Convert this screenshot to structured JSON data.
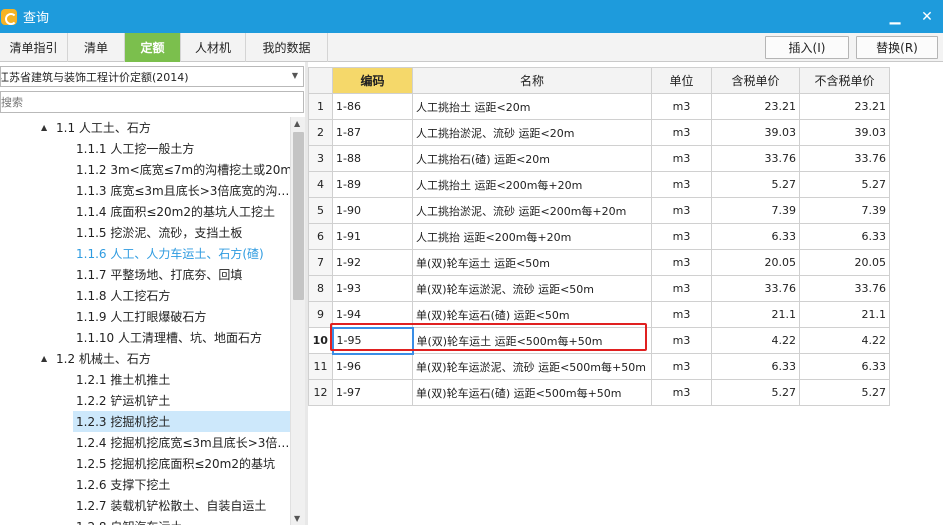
{
  "window": {
    "title": "查询",
    "minimize": "▁",
    "close": "✕"
  },
  "tabs": [
    {
      "label": "清单指引",
      "active": false
    },
    {
      "label": "清单",
      "active": false
    },
    {
      "label": "定额",
      "active": true
    },
    {
      "label": "人材机",
      "active": false
    },
    {
      "label": "我的数据",
      "active": false
    }
  ],
  "toolbar": {
    "insert_label": "插入(I)",
    "replace_label": "替换(R)"
  },
  "left": {
    "dropdown_value": "江苏省建筑与装饰工程计价定额(2014)",
    "search_placeholder": "搜索",
    "tree": [
      {
        "label": "1.1 人工土、石方",
        "level": 1,
        "expanded": true
      },
      {
        "label": "1.1.1 人工挖一般土方",
        "level": 2
      },
      {
        "label": "1.1.2 3m<底宽≤7m的沟槽挖土或20m2…",
        "level": 2
      },
      {
        "label": "1.1.3 底宽≤3m且底长>3倍底宽的沟…",
        "level": 2
      },
      {
        "label": "1.1.4 底面积≤20m2的基坑人工挖土",
        "level": 2
      },
      {
        "label": "1.1.5 挖淤泥、流砂，支挡土板",
        "level": 2
      },
      {
        "label": "1.1.6 人工、人力车运土、石方(碴)",
        "level": 2,
        "highlight": true
      },
      {
        "label": "1.1.7 平整场地、打底夯、回填",
        "level": 2
      },
      {
        "label": "1.1.8 人工挖石方",
        "level": 2
      },
      {
        "label": "1.1.9 人工打眼爆破石方",
        "level": 2
      },
      {
        "label": "1.1.10 人工清理槽、坑、地面石方",
        "level": 2
      },
      {
        "label": "1.2 机械土、石方",
        "level": 1,
        "expanded": true
      },
      {
        "label": "1.2.1 推土机推土",
        "level": 2
      },
      {
        "label": "1.2.2 铲运机铲土",
        "level": 2
      },
      {
        "label": "1.2.3 挖掘机挖土",
        "level": 2,
        "selected": true
      },
      {
        "label": "1.2.4 挖掘机挖底宽≤3m且底长>3倍…",
        "level": 2
      },
      {
        "label": "1.2.5 挖掘机挖底面积≤20m2的基坑",
        "level": 2
      },
      {
        "label": "1.2.6 支撑下挖土",
        "level": 2
      },
      {
        "label": "1.2.7 装载机铲松散土、自装自运土",
        "level": 2
      },
      {
        "label": "1.2.8 自卸汽车运土",
        "level": 2
      }
    ]
  },
  "grid": {
    "headers": [
      "",
      "编码",
      "名称",
      "单位",
      "含税单价",
      "不含税单价"
    ],
    "rows": [
      {
        "no": "1",
        "code": "1-86",
        "name": "人工挑抬土 运距<20m",
        "unit": "m3",
        "price_tax": "23.21",
        "price_notax": "23.21"
      },
      {
        "no": "2",
        "code": "1-87",
        "name": "人工挑抬淤泥、流砂 运距<20m",
        "unit": "m3",
        "price_tax": "39.03",
        "price_notax": "39.03"
      },
      {
        "no": "3",
        "code": "1-88",
        "name": "人工挑抬石(碴) 运距<20m",
        "unit": "m3",
        "price_tax": "33.76",
        "price_notax": "33.76"
      },
      {
        "no": "4",
        "code": "1-89",
        "name": "人工挑抬土 运距<200m每+20m",
        "unit": "m3",
        "price_tax": "5.27",
        "price_notax": "5.27"
      },
      {
        "no": "5",
        "code": "1-90",
        "name": "人工挑抬淤泥、流砂 运距<200m每+20m",
        "unit": "m3",
        "price_tax": "7.39",
        "price_notax": "7.39"
      },
      {
        "no": "6",
        "code": "1-91",
        "name": "人工挑抬 运距<200m每+20m",
        "unit": "m3",
        "price_tax": "6.33",
        "price_notax": "6.33"
      },
      {
        "no": "7",
        "code": "1-92",
        "name": "单(双)轮车运土 运距<50m",
        "unit": "m3",
        "price_tax": "20.05",
        "price_notax": "20.05"
      },
      {
        "no": "8",
        "code": "1-93",
        "name": "单(双)轮车运淤泥、流砂 运距<50m",
        "unit": "m3",
        "price_tax": "33.76",
        "price_notax": "33.76"
      },
      {
        "no": "9",
        "code": "1-94",
        "name": "单(双)轮车运石(碴) 运距<50m",
        "unit": "m3",
        "price_tax": "21.1",
        "price_notax": "21.1"
      },
      {
        "no": "10",
        "code": "1-95",
        "name": "单(双)轮车运土 运距<500m每+50m",
        "unit": "m3",
        "price_tax": "4.22",
        "price_notax": "4.22",
        "current": true
      },
      {
        "no": "11",
        "code": "1-96",
        "name": "单(双)轮车运淤泥、流砂 运距<500m每+50m",
        "unit": "m3",
        "price_tax": "6.33",
        "price_notax": "6.33"
      },
      {
        "no": "12",
        "code": "1-97",
        "name": "单(双)轮车运石(碴) 运距<500m每+50m",
        "unit": "m3",
        "price_tax": "5.27",
        "price_notax": "5.27"
      }
    ]
  },
  "colors": {
    "titlebar": "#1e9bdc",
    "active_tab": "#7bbf4d",
    "code_header": "#f5d86a",
    "highlight_box": "#e02020",
    "tree_link": "#2e9be0"
  }
}
